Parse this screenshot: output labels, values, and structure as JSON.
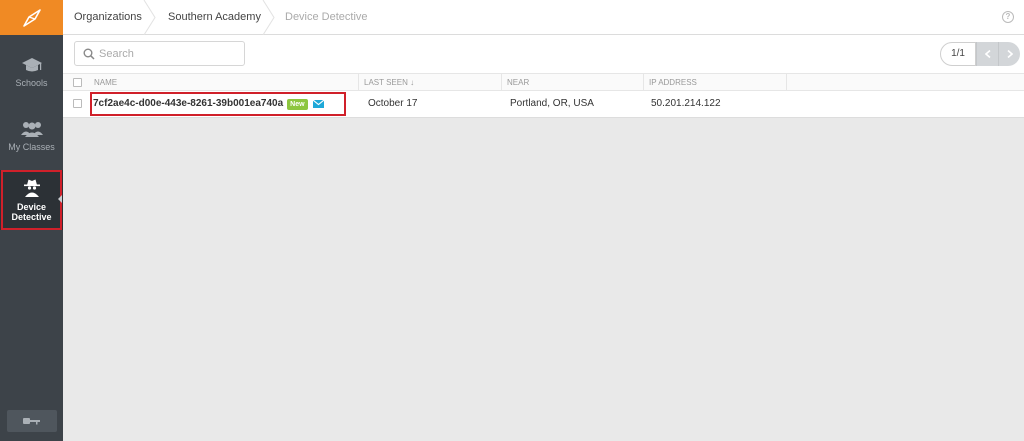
{
  "sidebar": {
    "items": [
      {
        "label": "Schools"
      },
      {
        "label": "My Classes"
      },
      {
        "label_line1": "Device",
        "label_line2": "Detective"
      }
    ]
  },
  "breadcrumb": [
    "Organizations",
    "Southern Academy",
    "Device Detective"
  ],
  "search": {
    "placeholder": "Search",
    "value": ""
  },
  "pager": {
    "count": "1/1"
  },
  "table": {
    "headers": {
      "name": "NAME",
      "last_seen": "LAST SEEN ↓",
      "near": "NEAR",
      "ip": "IP ADDRESS"
    },
    "rows": [
      {
        "name": "7cf2ae4c-d00e-443e-8261-39b001ea740a",
        "badge": "New",
        "last_seen": "October 17",
        "near": "Portland, OR, USA",
        "ip": "50.201.214.122"
      }
    ]
  },
  "colors": {
    "accent": "#f08a24",
    "sidebar": "#3d4349",
    "highlight": "#d0202a",
    "badge": "#8dc63f"
  }
}
